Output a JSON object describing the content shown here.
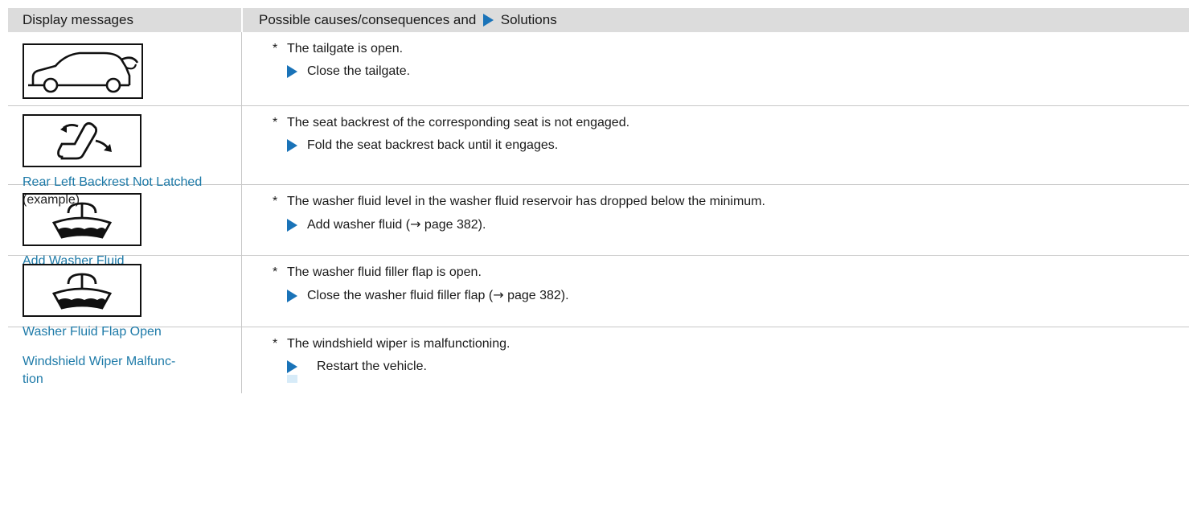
{
  "header": {
    "col1": "Display messages",
    "col2_prefix": "Possible causes/consequences and",
    "col2_suffix": "Solutions"
  },
  "rows": [
    {
      "icon": "tailgate-open-icon",
      "label_link": "",
      "label_suffix": "",
      "cause_bullet": "*",
      "cause": "The tailgate is open.",
      "solution": "Close the tailgate."
    },
    {
      "icon": "seat-backrest-icon",
      "label_link": "Rear Left Backrest Not Latched",
      "label_suffix": " (example)",
      "cause_bullet": "*",
      "cause": "The seat backrest of the corresponding seat is not engaged.",
      "solution": "Fold the seat backrest back until it engages."
    },
    {
      "icon": "washer-fluid-icon",
      "label_link": "Add Washer Fluid",
      "label_suffix": "",
      "cause_bullet": "*",
      "cause": "The washer fluid level in the washer fluid reservoir has dropped below the minimum.",
      "solution_pre": "Add washer fluid (",
      "solution_arrow": "→",
      "solution_post": " page 382)."
    },
    {
      "icon": "washer-fluid-icon",
      "label_link": "Washer Fluid Flap Open",
      "label_suffix": "",
      "cause_bullet": "*",
      "cause": "The washer fluid filler flap is open.",
      "solution_pre": "Close the washer fluid filler flap (",
      "solution_arrow": "→",
      "solution_post": " page 382)."
    },
    {
      "icon": "",
      "label_link": "Windshield Wiper Malfunc-\ntion",
      "label_suffix": "",
      "cause_bullet": "*",
      "cause": "The windshield wiper is malfunctioning.",
      "solution": "Restart the vehicle."
    }
  ],
  "colors": {
    "header_bg": "#dcdcdc",
    "accent_arrow": "#1a73b8",
    "link_text": "#1d7aa8",
    "divider": "#c8c8c8"
  }
}
